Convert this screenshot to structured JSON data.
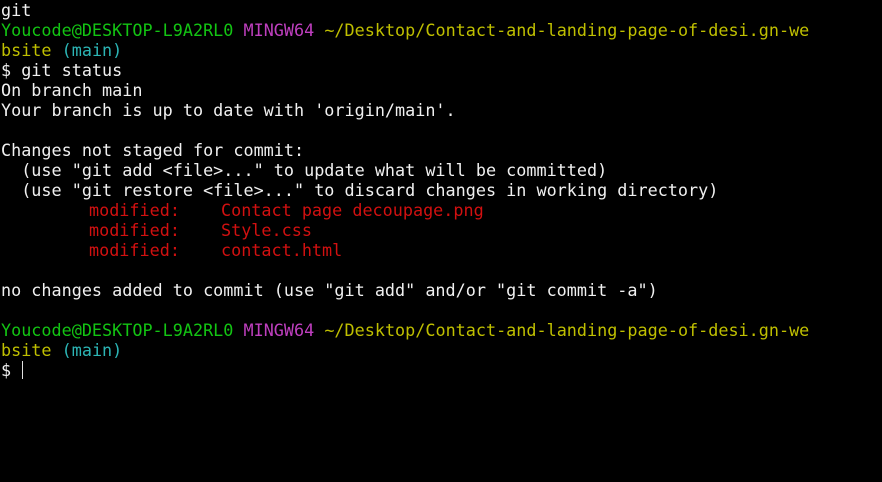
{
  "colors": {
    "background": "#000000",
    "text": "#f0f0f0",
    "user_host": "#13c413",
    "msystem": "#bf3fbf",
    "path": "#bfbf00",
    "branch": "#2cb5b5",
    "modified": "#d11010"
  },
  "output_top": "git",
  "prompt1": {
    "user_host": "Youcode@DESKTOP-L9A2RL0",
    "msystem": "MINGW64",
    "path_line1": "~/Desktop/Contact-and-landing-page-of-desi.gn-we",
    "path_line2": "bsite",
    "branch": "(main)"
  },
  "command": "$ git status",
  "status": {
    "on_branch": "On branch main",
    "up_to_date": "Your branch is up to date with 'origin/main'.",
    "changes_header": "Changes not staged for commit:",
    "hint_add": "  (use \"git add <file>...\" to update what will be committed)",
    "hint_restore": "  (use \"git restore <file>...\" to discard changes in working directory)",
    "modified_files": [
      {
        "label": "modified:",
        "file": "Contact page decoupage.png"
      },
      {
        "label": "modified:",
        "file": "Style.css"
      },
      {
        "label": "modified:",
        "file": "contact.html"
      }
    ],
    "summary": "no changes added to commit (use \"git add\" and/or \"git commit -a\")"
  },
  "prompt2": {
    "user_host": "Youcode@DESKTOP-L9A2RL0",
    "msystem": "MINGW64",
    "path_line1": "~/Desktop/Contact-and-landing-page-of-desi.gn-we",
    "path_line2": "bsite",
    "branch": "(main)"
  },
  "input_prompt": "$ "
}
